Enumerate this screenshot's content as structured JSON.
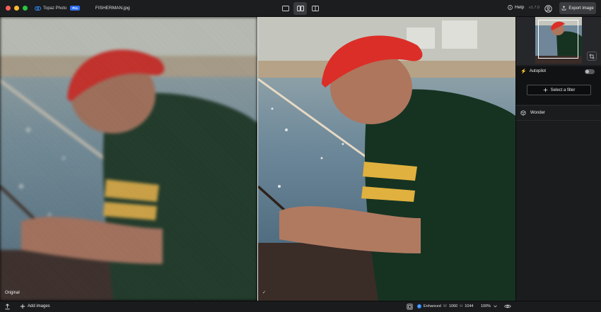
{
  "app": {
    "name": "Topaz Photo",
    "badge": "Pro",
    "filename": "FISHERMAN.jpg",
    "help_label": "Help",
    "version": "v1.7.0",
    "export_label": "Export image"
  },
  "viewer": {
    "left_label": "Original",
    "right_marker": "✓"
  },
  "sidebar": {
    "autopilot_label": "Autopilot",
    "autopilot_enabled": false,
    "select_filter_label": "Select a filter",
    "filters": [
      {
        "label": "Wonder"
      }
    ]
  },
  "bottom": {
    "add_images_label": "Add images",
    "enhanced_label": "Enhanced",
    "width_label": "W",
    "width_value": "1060",
    "height_label": "H",
    "height_value": "1044",
    "zoom": "100%"
  },
  "colors": {
    "accent_blue": "#2f8cff",
    "autopilot_lime": "#c8ff2e",
    "toolbar_bg": "#1c1d1f"
  }
}
